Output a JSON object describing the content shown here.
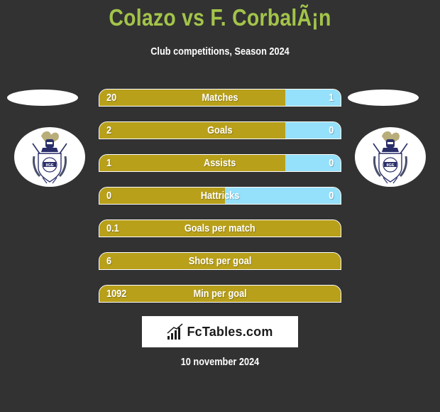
{
  "header": {
    "title": "Colazo vs F. CorbalÃ¡n",
    "subtitle": "Club competitions, Season 2024"
  },
  "players": {
    "left": {
      "name": "Colazo",
      "club_crest": "gimnasia-la-plata-crest"
    },
    "right": {
      "name": "F. CorbalÃ¡n",
      "club_crest": "gimnasia-la-plata-crest"
    }
  },
  "colors": {
    "title": "#a3c44a",
    "left_bar": "#b8a01a",
    "right_bar": "#95e0fb",
    "background": "#323232"
  },
  "stats": [
    {
      "label": "Matches",
      "left": "20",
      "right": "1",
      "left_share": 0.77
    },
    {
      "label": "Goals",
      "left": "2",
      "right": "0",
      "left_share": 0.77
    },
    {
      "label": "Assists",
      "left": "1",
      "right": "0",
      "left_share": 0.77
    },
    {
      "label": "Hattricks",
      "left": "0",
      "right": "0",
      "left_share": 0.52
    },
    {
      "label": "Goals per match",
      "left": "0.1",
      "right": "",
      "left_share": 1.0
    },
    {
      "label": "Shots per goal",
      "left": "6",
      "right": "",
      "left_share": 1.0
    },
    {
      "label": "Min per goal",
      "left": "1092",
      "right": "",
      "left_share": 1.0
    }
  ],
  "footer": {
    "brand": "FcTables.com",
    "brand_icon": "bar-chart-icon",
    "date": "10 november 2024"
  }
}
